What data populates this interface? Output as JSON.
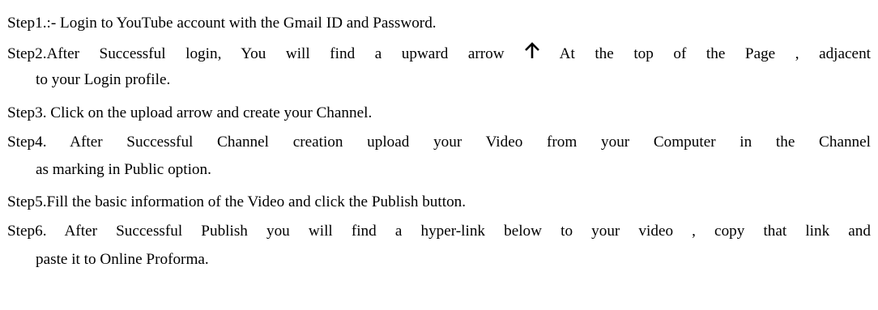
{
  "steps": [
    {
      "id": "step1",
      "line1": "Step1.:- Login to YouTube account with the Gmail ID and Password."
    },
    {
      "id": "step2",
      "line1_a": "Step2.After Successful login, You will find a upward arrow",
      "arrow_icon": "upward-arrow-icon",
      "line1_b": "At the top of the Page , adjacent",
      "line2": "to your Login profile."
    },
    {
      "id": "step3",
      "line1": "Step3. Click on the upload arrow and create your Channel."
    },
    {
      "id": "step4",
      "line1": "Step4.  After  Successful Channel creation upload your Video from your Computer in the Channel",
      "line2": "as marking in Public option."
    },
    {
      "id": "step5",
      "line1": "Step5.Fill the basic information of the Video and click the Publish button."
    },
    {
      "id": "step6",
      "line1": "Step6. After  Successful Publish you will find a hyper-link below to your video , copy that link and",
      "line2": "paste it to Online Proforma."
    }
  ]
}
